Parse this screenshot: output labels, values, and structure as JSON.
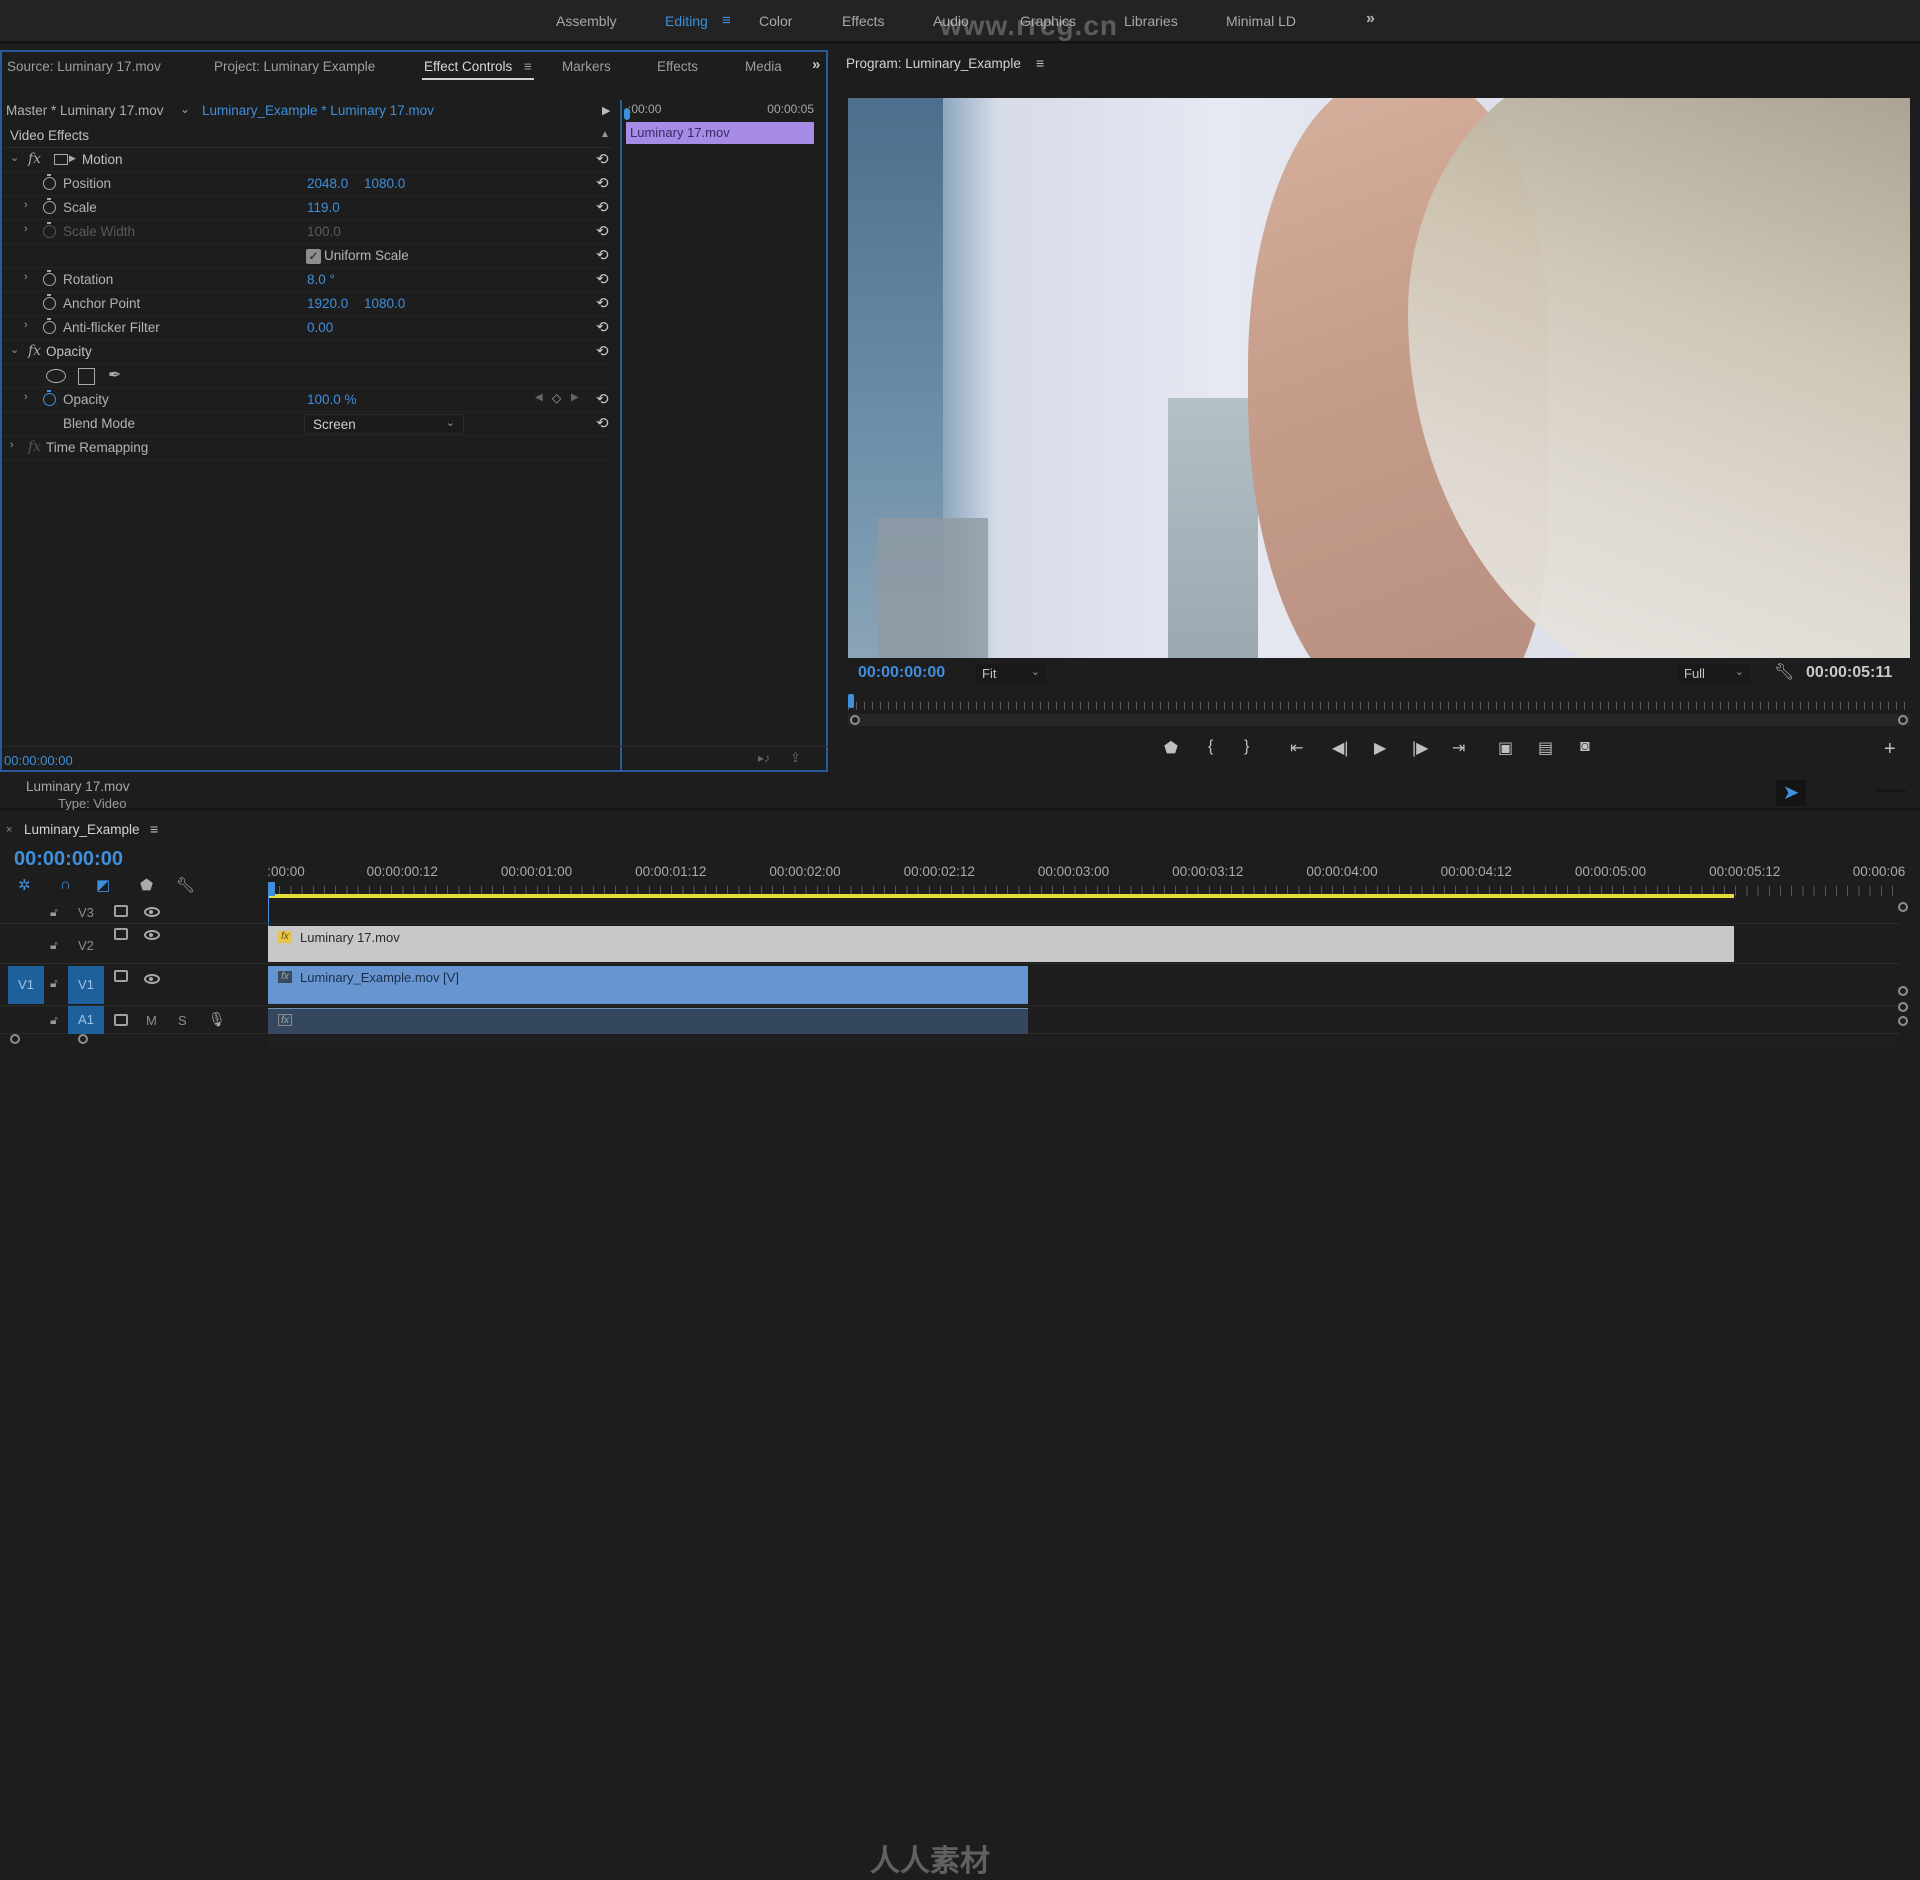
{
  "workspaces": {
    "items": [
      "Assembly",
      "Editing",
      "Color",
      "Effects",
      "Audio",
      "Graphics",
      "Libraries",
      "Minimal LD"
    ],
    "active": "Editing",
    "more": "»"
  },
  "watermark": {
    "url": "www.rrcg.cn",
    "bottom": "人人素材"
  },
  "effect_controls_panel": {
    "tabs": [
      "Source: Luminary 17.mov",
      "Project: Luminary Example",
      "Effect Controls",
      "Markers",
      "Effects",
      "Media"
    ],
    "active_tab": "Effect Controls",
    "menu_icon": "≡",
    "more": "»",
    "master_label": "Master * Luminary 17.mov",
    "sequence_clip": "Luminary_Example * Luminary 17.mov",
    "video_effects_label": "Video Effects",
    "motion": {
      "label": "Motion",
      "properties": [
        {
          "name": "Position",
          "values": [
            "2048.0",
            "1080.0"
          ],
          "twirl": false,
          "enabled": true
        },
        {
          "name": "Scale",
          "values": [
            "119.0"
          ],
          "twirl": true,
          "enabled": true
        },
        {
          "name": "Scale Width",
          "values": [
            "100.0"
          ],
          "twirl": true,
          "enabled": false
        },
        {
          "name": "Rotation",
          "values": [
            "8.0 °"
          ],
          "twirl": true,
          "enabled": true
        },
        {
          "name": "Anchor Point",
          "values": [
            "1920.0",
            "1080.0"
          ],
          "twirl": false,
          "enabled": true
        },
        {
          "name": "Anti-flicker Filter",
          "values": [
            "0.00"
          ],
          "twirl": true,
          "enabled": true
        }
      ],
      "uniform_scale_label": "Uniform Scale",
      "uniform_scale_checked": true
    },
    "opacity": {
      "label": "Opacity",
      "property_name": "Opacity",
      "value": "100.0 %",
      "blend_mode_label": "Blend Mode",
      "blend_mode_value": "Screen"
    },
    "time_remapping_label": "Time Remapping",
    "mini_timeline": {
      "start": ":00:00",
      "end": "00:00:05",
      "clip_name": "Luminary 17.mov",
      "clip_color": "#a68ce6"
    },
    "current_time": "00:00:00:00"
  },
  "info_panel": {
    "clip_name": "Luminary 17.mov",
    "type": "Type: Video"
  },
  "program_monitor": {
    "title": "Program: Luminary_Example",
    "menu_icon": "≡",
    "current_time": "00:00:00:00",
    "zoom_select": "Fit",
    "resolution_select": "Full",
    "duration": "00:00:05:11",
    "transport_icons": [
      "marker-icon",
      "mark-in-icon",
      "mark-out-icon",
      "go-to-in-icon",
      "step-back-icon",
      "play-icon",
      "step-forward-icon",
      "go-to-out-icon",
      "lift-icon",
      "extract-icon",
      "export-frame-icon"
    ],
    "transport_glyphs": [
      "⬟",
      "{",
      "}",
      "⇤",
      "◀|",
      "▶",
      "|▶",
      "⇥",
      "▣",
      "▤",
      "◙"
    ]
  },
  "timeline": {
    "sequence_name": "Luminary_Example",
    "menu_icon": "≡",
    "current_time": "00:00:00:00",
    "ruler_labels": [
      ":00:00",
      "00:00:00:12",
      "00:00:01:00",
      "00:00:01:12",
      "00:00:02:00",
      "00:00:02:12",
      "00:00:03:00",
      "00:00:03:12",
      "00:00:04:00",
      "00:00:04:12",
      "00:00:05:00",
      "00:00:05:12",
      "00:00:06"
    ],
    "tracks": [
      {
        "id": "V3",
        "source_patch": ""
      },
      {
        "id": "V2",
        "source_patch": ""
      },
      {
        "id": "V1",
        "source_patch": "V1"
      },
      {
        "id": "A1",
        "source_patch": "",
        "mute": "M",
        "solo": "S"
      }
    ],
    "clips": [
      {
        "name": "Luminary 17.mov",
        "track": "V2",
        "start_sec": 0,
        "end_sec": 5.46,
        "color": "#c8c8c8"
      },
      {
        "name": "Luminary_Example.mov [V]",
        "track": "V1",
        "start_sec": 0,
        "end_sec": 2.83,
        "color": "#6795cf"
      },
      {
        "name": "",
        "track": "A1",
        "start_sec": 0,
        "end_sec": 2.83,
        "color": "#34475f"
      }
    ],
    "work_area_end_sec": 5.46,
    "accent_color": "#3f8fdb",
    "work_area_color": "#e3de3c"
  }
}
